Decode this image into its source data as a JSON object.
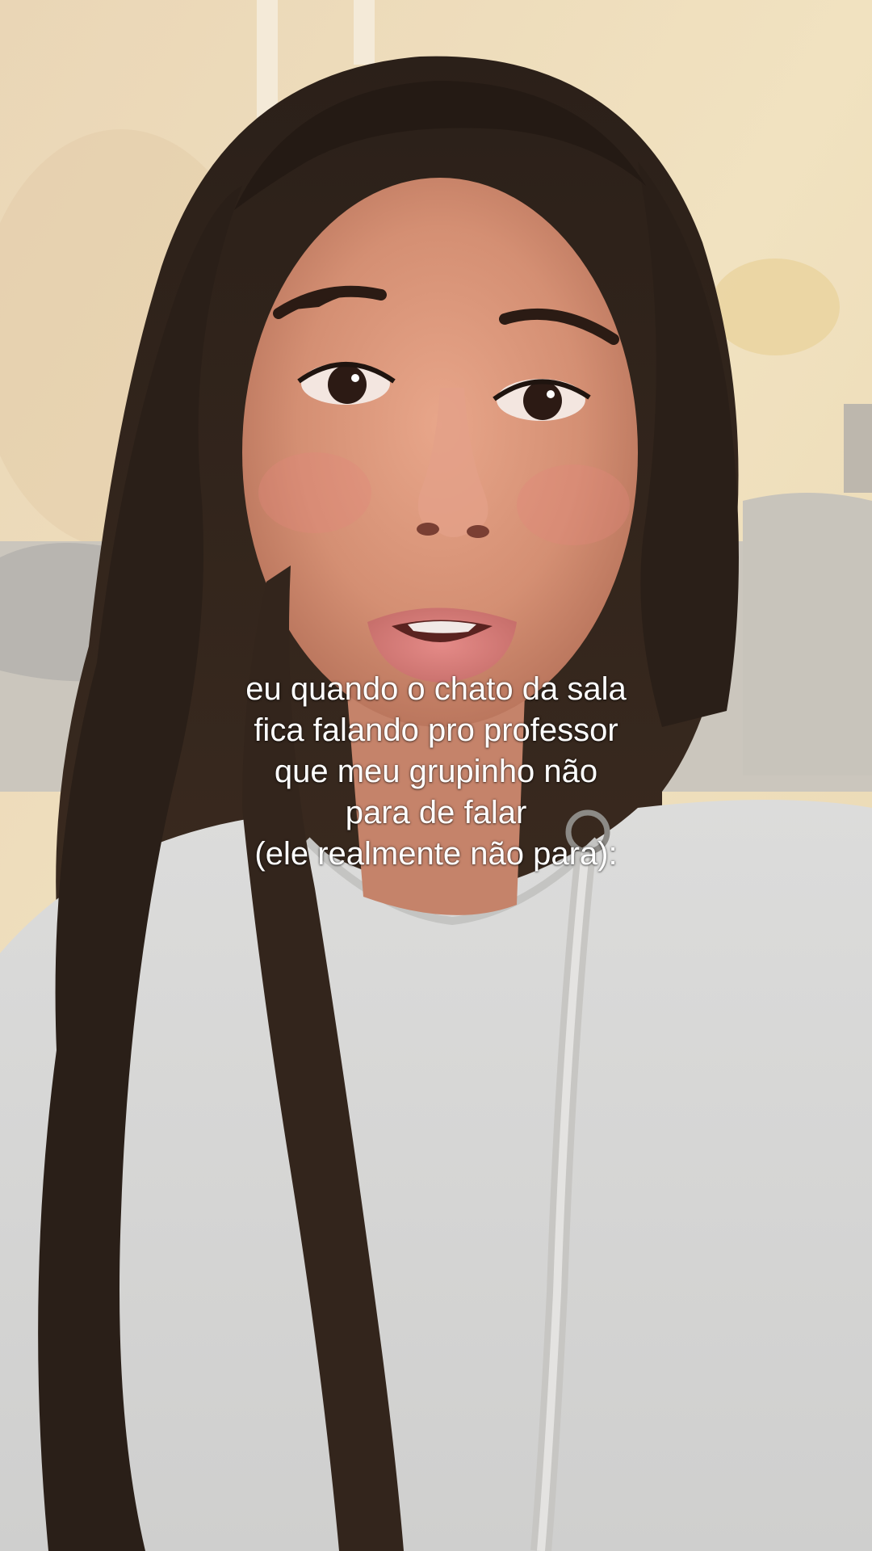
{
  "caption": {
    "lines": [
      "eu quando o chato da sala",
      "fica falando pro professor",
      "que meu grupinho não",
      "para de falar",
      "(ele realmente não para):"
    ]
  },
  "colors": {
    "wall": "#eedcb6",
    "hoodie": "#d9d8d6",
    "hair": "#2e221a",
    "skin": "#d9977c",
    "caption_text": "#ffffff"
  }
}
